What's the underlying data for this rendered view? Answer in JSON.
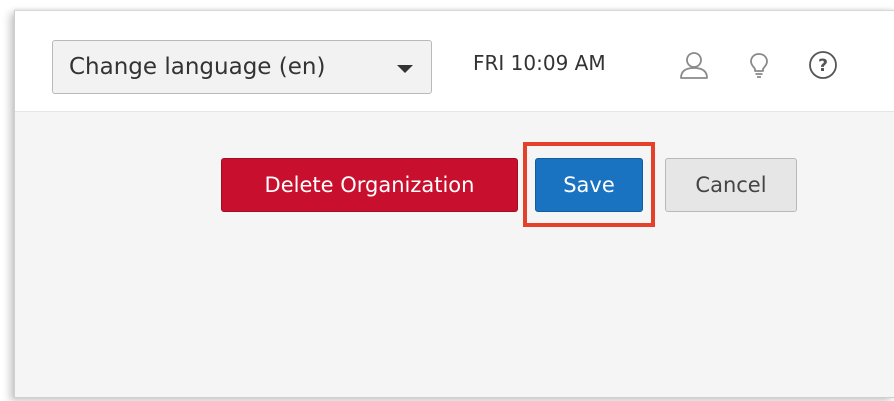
{
  "header": {
    "language_select": {
      "label": "Change language (en)"
    },
    "clock": "FRI 10:09 AM",
    "icons": [
      "user-icon",
      "lightbulb-icon",
      "help-icon"
    ]
  },
  "actions": {
    "delete_label": "Delete Organization",
    "save_label": "Save",
    "cancel_label": "Cancel"
  },
  "colors": {
    "delete": "#c8102e",
    "save": "#1a73c1",
    "highlight": "#e3412a"
  }
}
